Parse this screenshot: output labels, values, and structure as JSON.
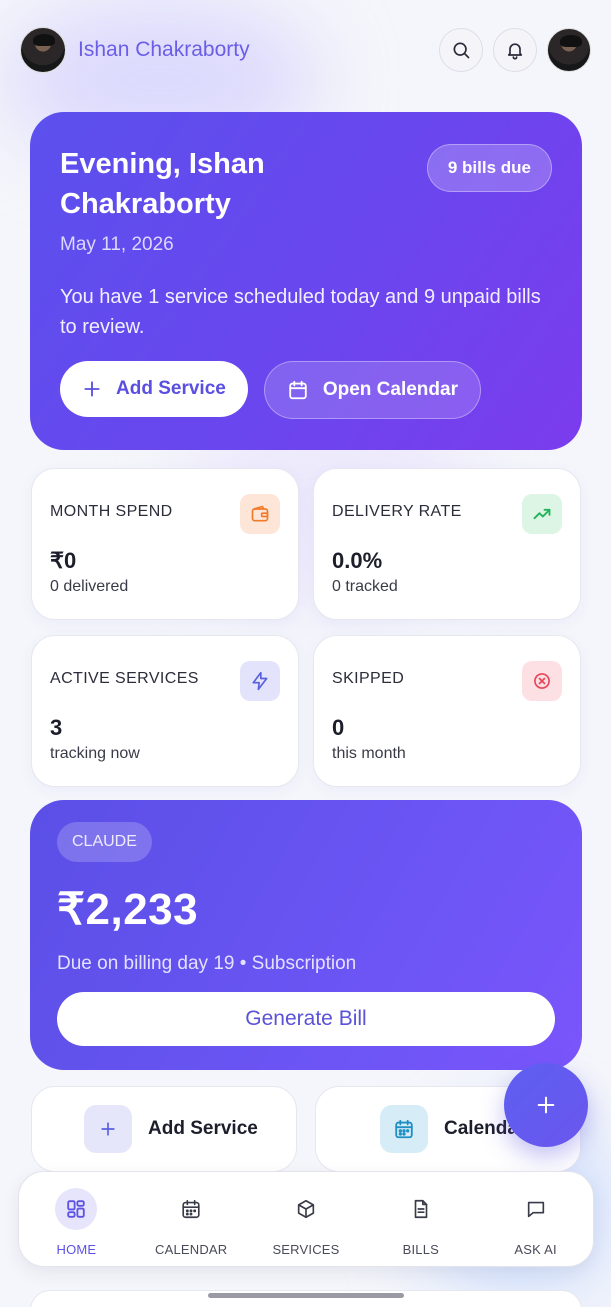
{
  "header": {
    "user_name": "Ishan Chakraborty"
  },
  "hero": {
    "greeting": "Evening, Ishan Chakraborty",
    "date": "May 11, 2026",
    "message": "You have 1 service scheduled today and 9 unpaid bills to review.",
    "badge": "9 bills due",
    "add_service_label": "Add Service",
    "open_calendar_label": "Open Calendar"
  },
  "stats": [
    {
      "label": "MONTH SPEND",
      "value": "₹0",
      "sub": "0 delivered",
      "icon": "wallet-icon",
      "color": "#f07a2a"
    },
    {
      "label": "DELIVERY RATE",
      "value": "0.0%",
      "sub": "0 tracked",
      "icon": "trending-up-icon",
      "color": "#22b35a"
    },
    {
      "label": "ACTIVE SERVICES",
      "value": "3",
      "sub": "tracking now",
      "icon": "lightning-icon",
      "color": "#5a5fe0"
    },
    {
      "label": "SKIPPED",
      "value": "0",
      "sub": "this month",
      "icon": "x-circle-icon",
      "color": "#e8465a"
    }
  ],
  "due_card": {
    "tag": "CLAUDE",
    "amount": "₹2,233",
    "subtitle": "Due on billing day 19 • Subscription",
    "button_label": "Generate Bill"
  },
  "quick_actions": [
    {
      "label": "Add Service",
      "icon": "plus-icon"
    },
    {
      "label": "Calendar",
      "icon": "calendar-icon"
    }
  ],
  "nav": [
    {
      "label": "HOME",
      "icon": "grid-icon",
      "active": true
    },
    {
      "label": "CALENDAR",
      "icon": "calendar-icon",
      "active": false
    },
    {
      "label": "SERVICES",
      "icon": "box-icon",
      "active": false
    },
    {
      "label": "BILLS",
      "icon": "document-icon",
      "active": false
    },
    {
      "label": "ASK AI",
      "icon": "chat-icon",
      "active": false
    }
  ],
  "colors": {
    "accent": "#5b50ee",
    "hero_end": "#7b3cee"
  }
}
